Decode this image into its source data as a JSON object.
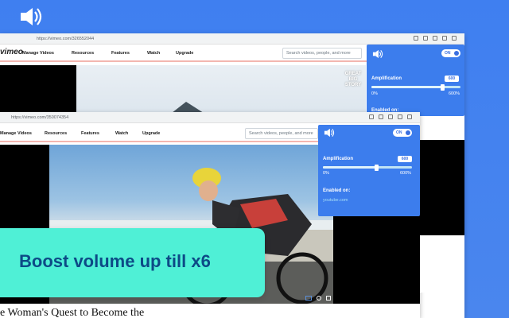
{
  "back_window": {
    "url": "https://vimeo.com/326552044",
    "brand": "vimeo",
    "nav": [
      "Manage Videos",
      "Resources",
      "Features",
      "Watch",
      "Upgrade"
    ],
    "search_placeholder": "Search videos, people, and more",
    "badge_lines": [
      "GREAT",
      "BIG",
      "STORY"
    ]
  },
  "front_window": {
    "url": "https://vimeo.com/350074354",
    "nav": [
      "Manage Videos",
      "Resources",
      "Features",
      "Watch",
      "Upgrade"
    ],
    "search_placeholder": "Search videos, people, and more",
    "headline": "e Woman's Quest to Become the"
  },
  "popup_back": {
    "toggle": "ON",
    "amplification_label": "Amplification",
    "amplification_value": "600",
    "min": "0%",
    "max": "600%",
    "enabled_label": "Enabled on:",
    "slider_level": 0.8
  },
  "popup_front": {
    "toggle": "ON",
    "amplification_label": "Amplification",
    "amplification_value": "600",
    "min": "0%",
    "max": "600%",
    "enabled_label": "Enabled on:",
    "enabled_site": "youtube.com",
    "slider_level": 0.6
  },
  "promo": {
    "text": "Boost volume up till x6"
  },
  "colors": {
    "background": "#3d7de8",
    "panel": "#3c7ded",
    "banner": "#4ff0d6",
    "banner_text": "#0d4a86"
  }
}
